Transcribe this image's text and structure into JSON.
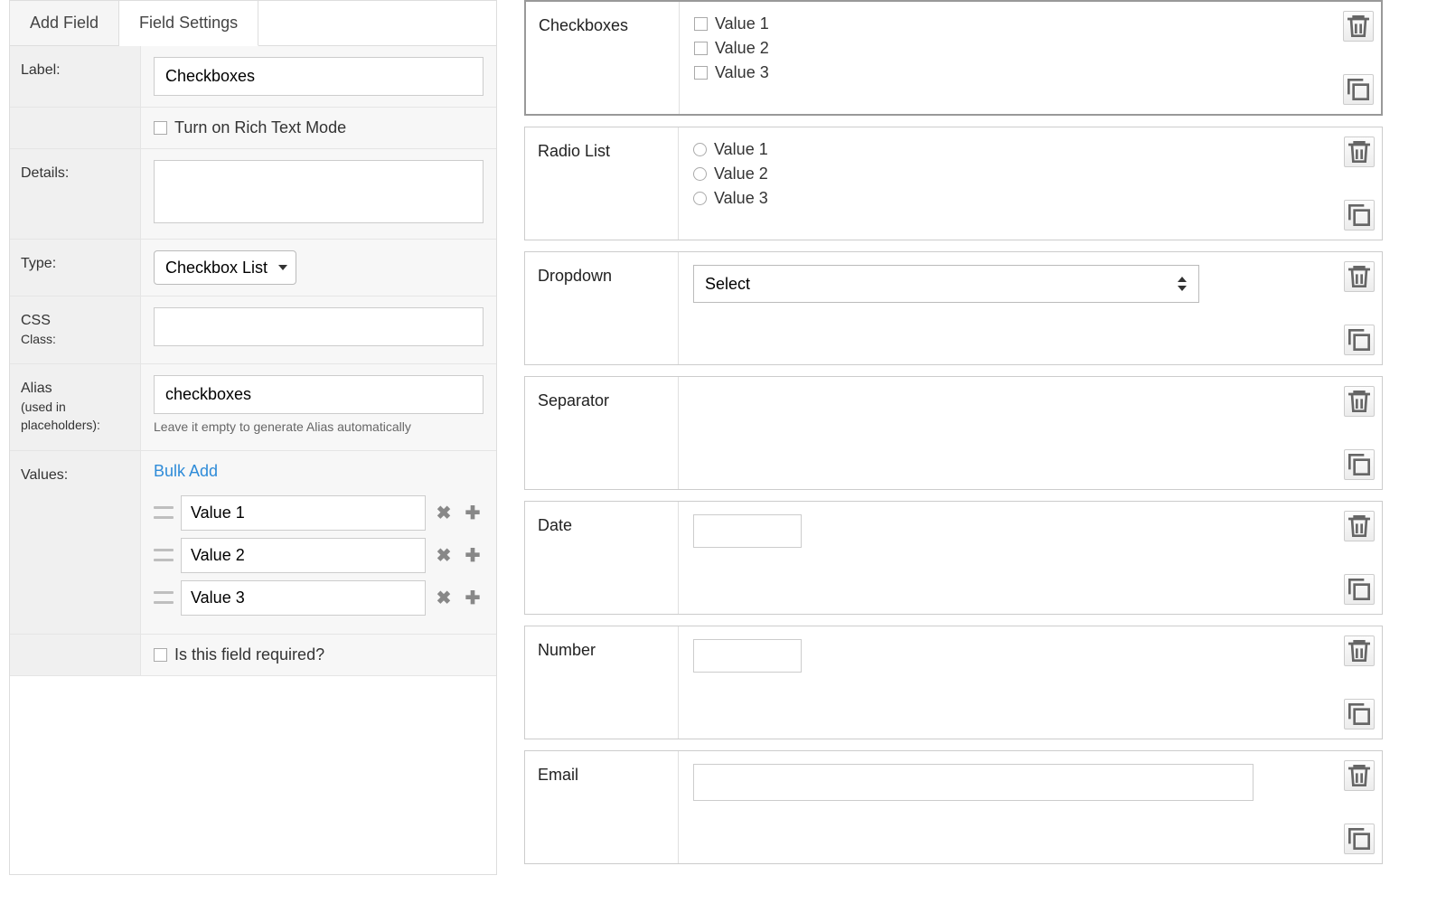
{
  "tabs": {
    "add_field": "Add Field",
    "field_settings": "Field Settings"
  },
  "settings": {
    "label_label": "Label:",
    "label_value": "Checkboxes",
    "rich_text_label": "Turn on Rich Text Mode",
    "details_label": "Details:",
    "details_value": "",
    "type_label": "Type:",
    "type_value": "Checkbox List",
    "css_label_1": "CSS",
    "css_label_2": "Class:",
    "css_value": "",
    "alias_label_1": "Alias",
    "alias_label_2": "(used in",
    "alias_label_3": "placeholders):",
    "alias_value": "checkboxes",
    "alias_hint": "Leave it empty to generate Alias automatically",
    "values_label": "Values:",
    "bulk_add": "Bulk Add",
    "values": [
      "Value 1",
      "Value 2",
      "Value 3"
    ],
    "required_label": "Is this field required?"
  },
  "preview": {
    "checkboxes": {
      "label": "Checkboxes",
      "options": [
        "Value 1",
        "Value 2",
        "Value 3"
      ]
    },
    "radio": {
      "label": "Radio List",
      "options": [
        "Value 1",
        "Value 2",
        "Value 3"
      ]
    },
    "dropdown": {
      "label": "Dropdown",
      "selected": "Select"
    },
    "separator": {
      "label": "Separator"
    },
    "date": {
      "label": "Date"
    },
    "number": {
      "label": "Number"
    },
    "email": {
      "label": "Email"
    }
  }
}
